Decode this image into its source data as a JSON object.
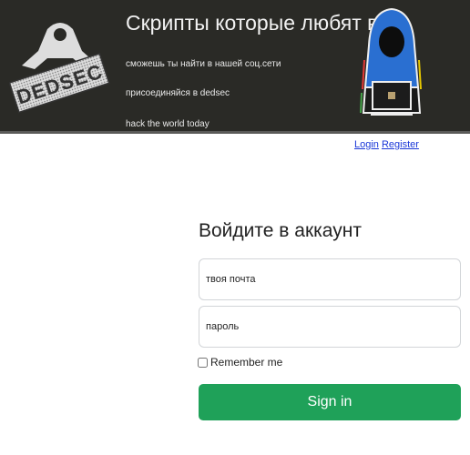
{
  "header": {
    "title": "Скрипты которые любят все",
    "lines": [
      "сможешь ты найти в нашей соц.сети",
      "присоединяйся в dedsec",
      "hack the world today"
    ],
    "logo_text": "DEDSEC"
  },
  "nav": {
    "login": "Login",
    "register": "Register"
  },
  "form": {
    "title": "Войдите в аккаунт",
    "email_placeholder": "твоя почта",
    "password_placeholder": "пароль",
    "remember_label": "Remember me",
    "signin_label": "Sign in"
  },
  "colors": {
    "header_bg": "#2a2a26",
    "button": "#1fa159",
    "link": "#1a37d8"
  }
}
